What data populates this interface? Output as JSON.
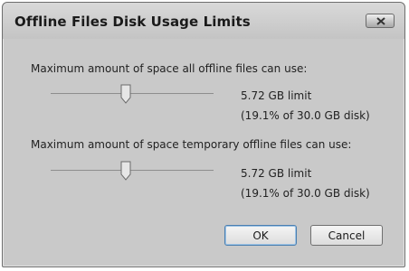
{
  "window": {
    "title": "Offline Files Disk Usage Limits"
  },
  "all_files": {
    "label": "Maximum amount of space all offline files can use:",
    "limit_text": "5.72 GB limit",
    "percent_text": "(19.1% of 30.0 GB disk)",
    "slider_fraction": 0.46
  },
  "temp_files": {
    "label": "Maximum amount of space temporary offline files can use:",
    "limit_text": "5.72 GB limit",
    "percent_text": "(19.1% of 30.0 GB disk)",
    "slider_fraction": 0.46
  },
  "buttons": {
    "ok_label": "OK",
    "cancel_label": "Cancel"
  },
  "icons": {
    "close": "close-icon"
  }
}
